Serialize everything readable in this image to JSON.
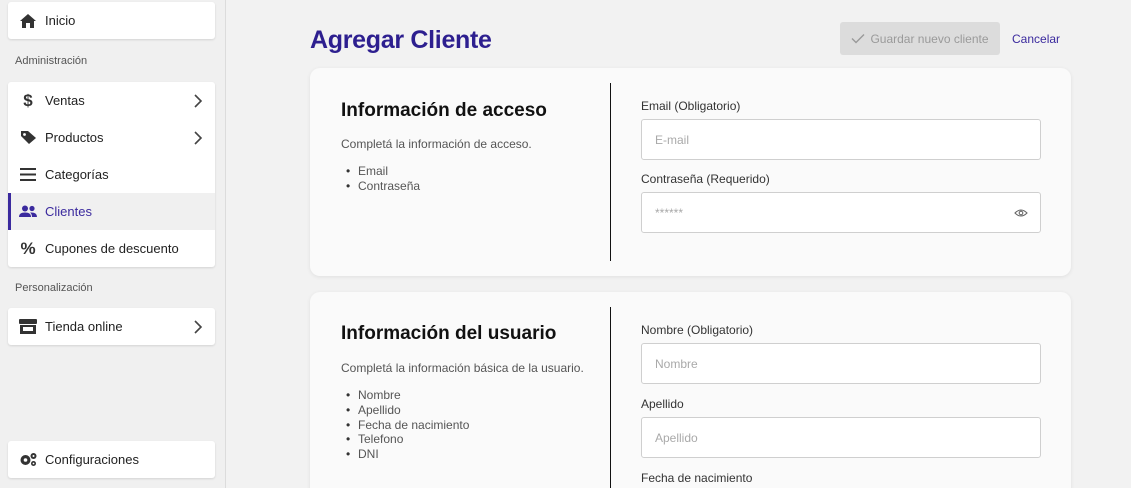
{
  "sidebar": {
    "top": {
      "label": "Inicio",
      "icon": "home-icon"
    },
    "admin_title": "Administración",
    "admin_items": [
      {
        "label": "Ventas",
        "icon": "dollar-icon",
        "has_chevron": true
      },
      {
        "label": "Productos",
        "icon": "tag-icon",
        "has_chevron": true
      },
      {
        "label": "Categorías",
        "icon": "list-icon",
        "has_chevron": false
      },
      {
        "label": "Clientes",
        "icon": "users-icon",
        "has_chevron": false,
        "active": true
      },
      {
        "label": "Cupones de descuento",
        "icon": "percent-icon",
        "has_chevron": false
      }
    ],
    "personal_title": "Personalización",
    "personal_items": [
      {
        "label": "Tienda online",
        "icon": "store-icon",
        "has_chevron": true
      }
    ],
    "bottom": {
      "label": "Configuraciones",
      "icon": "gears-icon"
    }
  },
  "header": {
    "title": "Agregar Cliente",
    "save_label": "Guardar nuevo cliente",
    "cancel_label": "Cancelar"
  },
  "access_panel": {
    "title": "Información de acceso",
    "description": "Completá la información de acceso.",
    "bullets": [
      "Email",
      "Contraseña"
    ],
    "fields": [
      {
        "label": "Email (Obligatorio)",
        "placeholder": "E-mail"
      },
      {
        "label": "Contraseña (Requerido)",
        "placeholder": "******"
      }
    ]
  },
  "user_panel": {
    "title": "Información del usuario",
    "description": "Completá la información básica de la usuario.",
    "bullets": [
      "Nombre",
      "Apellido",
      "Fecha de nacimiento",
      "Telefono",
      "DNI"
    ],
    "fields": [
      {
        "label": "Nombre (Obligatorio)",
        "placeholder": "Nombre"
      },
      {
        "label": "Apellido",
        "placeholder": "Apellido"
      },
      {
        "label": "Fecha de nacimiento",
        "placeholder": ""
      }
    ]
  },
  "colors": {
    "accent": "#2d1f8f",
    "active_bar": "#3b2a9e",
    "disabled_button": "#dcdcdc"
  }
}
